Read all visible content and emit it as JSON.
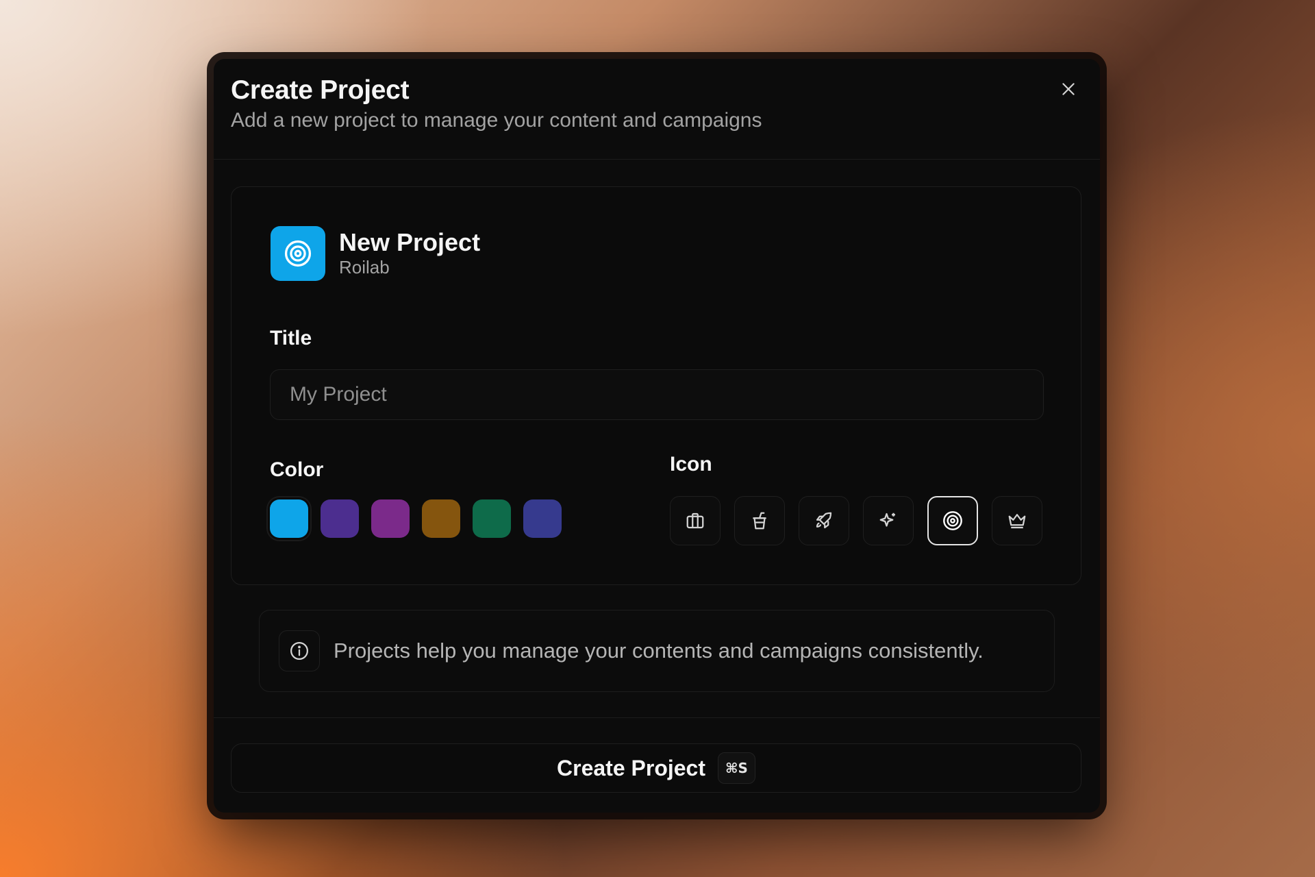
{
  "modal": {
    "title": "Create Project",
    "subtitle": "Add a new project to manage your content and campaigns",
    "close_icon": "close-icon"
  },
  "preview": {
    "name": "New Project",
    "org": "Roilab",
    "icon": "target-icon",
    "color": "#0ea5e9"
  },
  "form": {
    "title_label": "Title",
    "title_placeholder": "My Project",
    "title_value": "",
    "color_label": "Color",
    "icon_label": "Icon",
    "colors": [
      "#0ea5e9",
      "#4c2e8f",
      "#7b2a8a",
      "#85550e",
      "#0e6b4a",
      "#363a8e"
    ],
    "selected_color": 0,
    "icons": [
      "briefcase-icon",
      "cup-icon",
      "rocket-icon",
      "sparkle-icon",
      "target-icon",
      "crown-icon"
    ],
    "selected_icon": 4
  },
  "info": {
    "icon": "info-icon",
    "text": "Projects help you manage your contents and campaigns consistently."
  },
  "footer": {
    "create_label": "Create Project",
    "shortcut": "⌘S"
  }
}
